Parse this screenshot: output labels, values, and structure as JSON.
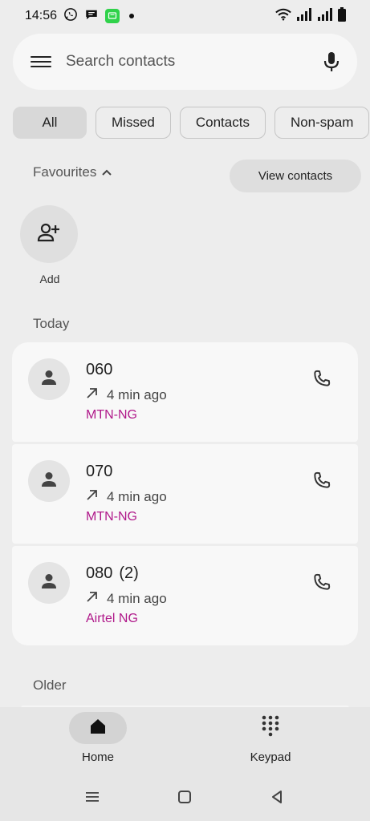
{
  "status_bar": {
    "time": "14:56",
    "left_icons": [
      "whatsapp-icon",
      "message-bubble-icon",
      "green-sms-icon"
    ],
    "right_icons": [
      "wifi-icon",
      "signal-icon",
      "signal-icon",
      "battery-icon"
    ]
  },
  "search": {
    "placeholder": "Search contacts"
  },
  "chips": [
    {
      "label": "All",
      "active": true
    },
    {
      "label": "Missed",
      "active": false
    },
    {
      "label": "Contacts",
      "active": false
    },
    {
      "label": "Non-spam",
      "active": false
    }
  ],
  "favourites": {
    "label": "Favourites",
    "view_contacts_label": "View contacts",
    "add_label": "Add"
  },
  "sections": {
    "today": "Today",
    "older": "Older"
  },
  "calls": [
    {
      "name": "060",
      "count": "",
      "direction": "outgoing",
      "time": "4 min ago",
      "carrier": "MTN-NG"
    },
    {
      "name": "070",
      "count": "",
      "direction": "outgoing",
      "time": "4 min ago",
      "carrier": "MTN-NG"
    },
    {
      "name": "080",
      "count": "(2)",
      "direction": "outgoing",
      "time": "4 min ago",
      "carrier": "Airtel NG"
    }
  ],
  "bottom_nav": {
    "home": "Home",
    "keypad": "Keypad"
  },
  "colors": {
    "carrier": "#b0198a",
    "background": "#ededed",
    "card": "#f8f8f8"
  }
}
